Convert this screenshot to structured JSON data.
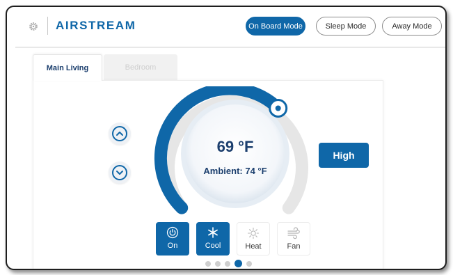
{
  "header": {
    "brand": "AIRSTREAM",
    "modes": [
      {
        "label": "On Board Mode",
        "active": true
      },
      {
        "label": "Sleep Mode",
        "active": false
      },
      {
        "label": "Away Mode",
        "active": false
      }
    ]
  },
  "tabs": [
    {
      "label": "Main Living",
      "active": true
    },
    {
      "label": "Bedroom",
      "active": false
    }
  ],
  "thermostat": {
    "setpoint": "69 °F",
    "ambient": "Ambient: 74 °F",
    "fan_speed": "High"
  },
  "hvac_modes": [
    {
      "label": "On",
      "icon": "power-icon",
      "active": true
    },
    {
      "label": "Cool",
      "icon": "snowflake-icon",
      "active": true
    },
    {
      "label": "Heat",
      "icon": "sun-icon",
      "active": false
    },
    {
      "label": "Fan",
      "icon": "fan-icon",
      "active": false
    }
  ],
  "pagination": {
    "total": 5,
    "current": 4
  },
  "colors": {
    "accent": "#0f67a8",
    "text_dark": "#1c3f6e"
  }
}
